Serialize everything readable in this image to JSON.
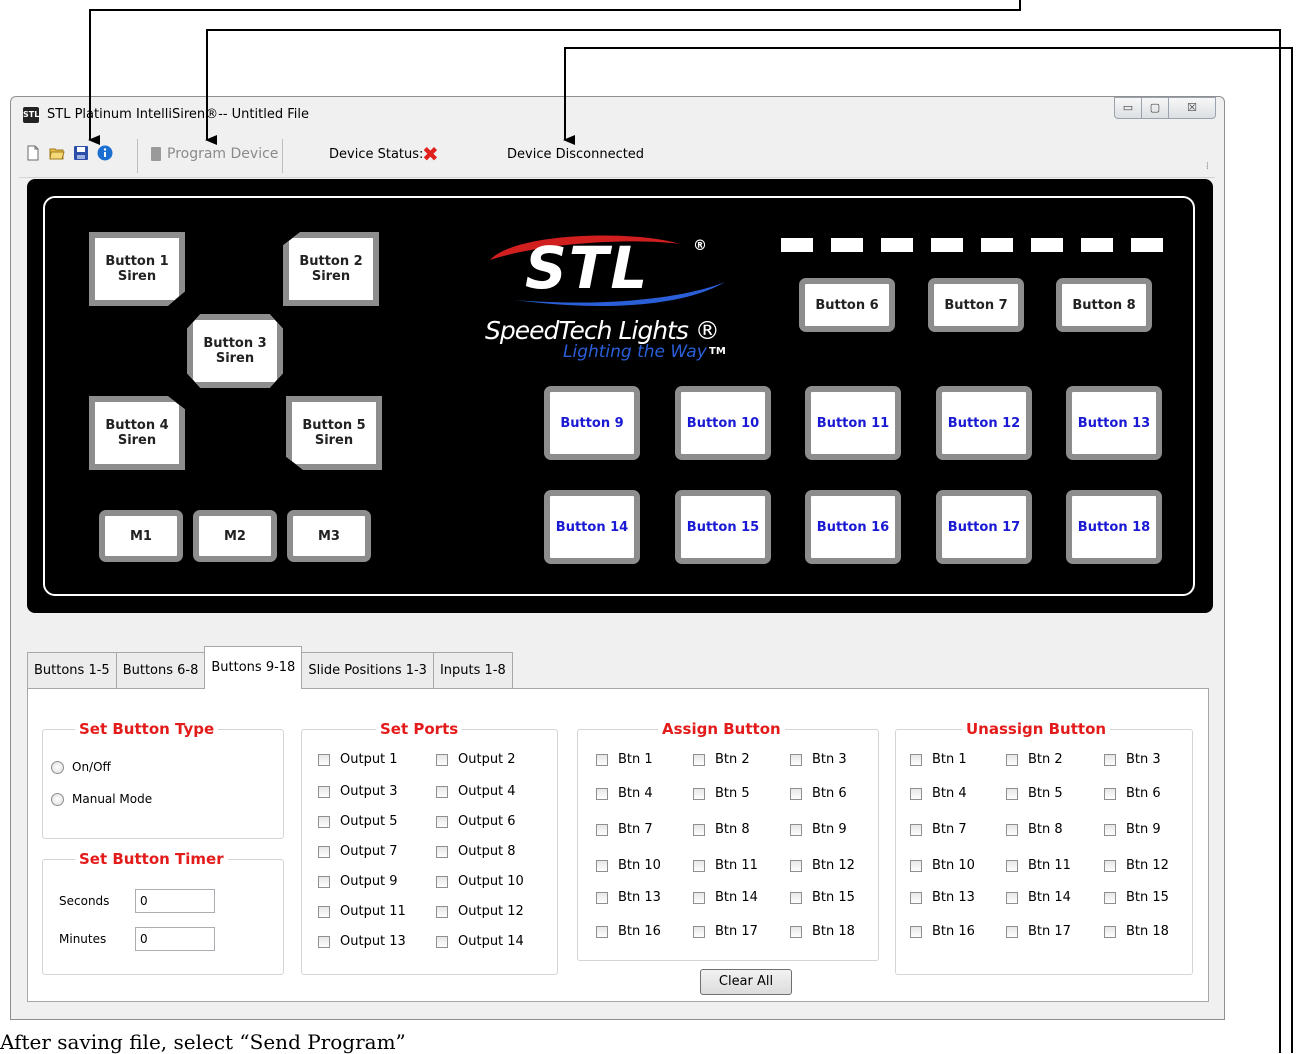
{
  "window": {
    "title": "STL Platinum IntelliSiren®-- Untitled File",
    "app_icon_text": "STL",
    "controls": {
      "minimize": "▭",
      "maximize": "▢",
      "close": "☒"
    }
  },
  "toolbar": {
    "program_label": "Program Device",
    "device_status_label": "Device Status:",
    "status_icon": "✖",
    "connection_text": "Device Disconnected"
  },
  "device": {
    "logo": {
      "brand": "STL",
      "reg": "®",
      "name": "SpeedTech Lights ®",
      "tagline": "Lighting the Way",
      "tm": "TM"
    },
    "siren_buttons": [
      {
        "label": "Button 1\nSiren"
      },
      {
        "label": "Button 2\nSiren"
      },
      {
        "label": "Button 3\nSiren"
      },
      {
        "label": "Button 4\nSiren"
      },
      {
        "label": "Button 5\nSiren"
      }
    ],
    "mode_buttons": [
      "M1",
      "M2",
      "M3"
    ],
    "top_buttons": [
      "Button 6",
      "Button 7",
      "Button 8"
    ],
    "row1_buttons": [
      "Button 9",
      "Button 10",
      "Button 11",
      "Button 12",
      "Button 13"
    ],
    "row2_buttons": [
      "Button 14",
      "Button 15",
      "Button 16",
      "Button 17",
      "Button 18"
    ],
    "accent_blue": "#1a1ad4"
  },
  "tabs": [
    "Buttons 1-5",
    "Buttons 6-8",
    "Buttons 9-18",
    "Slide Positions 1-3",
    "Inputs 1-8"
  ],
  "active_tab": "Buttons 9-18",
  "set_button_type": {
    "title": "Set Button Type",
    "options": [
      "On/Off",
      "Manual Mode"
    ]
  },
  "set_button_timer": {
    "title": "Set Button Timer",
    "seconds_label": "Seconds",
    "seconds_value": "0",
    "minutes_label": "Minutes",
    "minutes_value": "0"
  },
  "set_ports": {
    "title": "Set Ports",
    "outputs": [
      "Output 1",
      "Output 2",
      "Output 3",
      "Output 4",
      "Output 5",
      "Output 6",
      "Output 7",
      "Output 8",
      "Output 9",
      "Output 10",
      "Output 11",
      "Output 12",
      "Output 13",
      "Output 14"
    ]
  },
  "assign_button": {
    "title": "Assign Button",
    "items": [
      "Btn 1",
      "Btn 2",
      "Btn 3",
      "Btn 4",
      "Btn 5",
      "Btn 6",
      "Btn 7",
      "Btn 8",
      "Btn 9",
      "Btn 10",
      "Btn 11",
      "Btn 12",
      "Btn 13",
      "Btn 14",
      "Btn 15",
      "Btn 16",
      "Btn 17",
      "Btn 18"
    ]
  },
  "unassign_button": {
    "title": "Unassign Button",
    "items": [
      "Btn 1",
      "Btn 2",
      "Btn 3",
      "Btn 4",
      "Btn 5",
      "Btn 6",
      "Btn 7",
      "Btn 8",
      "Btn 9",
      "Btn 10",
      "Btn 11",
      "Btn 12",
      "Btn 13",
      "Btn 14",
      "Btn 15",
      "Btn 16",
      "Btn 17",
      "Btn 18"
    ]
  },
  "clear_all_label": "Clear All",
  "caption": "After saving file, select “Send Program”"
}
